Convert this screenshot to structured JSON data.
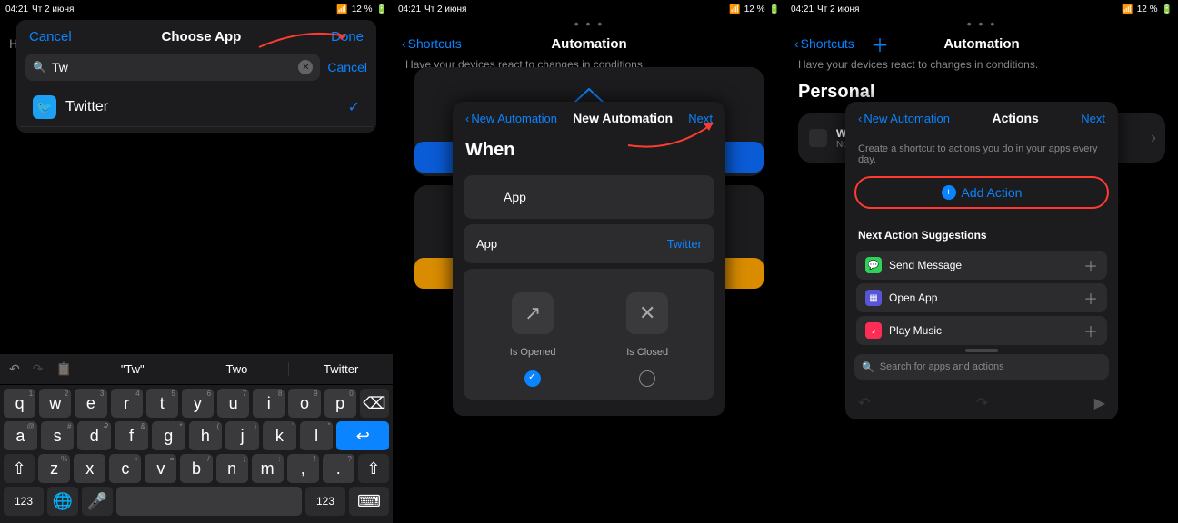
{
  "status": {
    "time": "04:21",
    "date": "Чт 2 июня",
    "battery": "12 %"
  },
  "panel1": {
    "home": "H…",
    "cancel": "Cancel",
    "title": "Choose App",
    "done": "Done",
    "search_value": "Tw",
    "search_cancel": "Cancel",
    "app_name": "Twitter",
    "suggestions": {
      "w1": "\"Tw\"",
      "w2": "Two",
      "w3": "Twitter"
    },
    "key_123": "123"
  },
  "panel2": {
    "back": "Shortcuts",
    "title": "Automation",
    "sub": "Have your devices react to changes in conditions.",
    "modal_back": "New Automation",
    "modal_title": "New Automation",
    "modal_next": "Next",
    "when": "When",
    "app": "App",
    "app_label": "App",
    "app_value": "Twitter",
    "is_opened": "Is Opened",
    "is_closed": "Is Closed"
  },
  "panel3": {
    "back": "Shortcuts",
    "title": "Automation",
    "sub": "Have your devices react to changes in conditions.",
    "personal": "Personal",
    "when_tw": "When \"Tw…",
    "no_actions": "No actions",
    "modal_back": "New Automation",
    "modal_title": "Actions",
    "modal_next": "Next",
    "hint": "Create a shortcut to actions you do in your apps every day.",
    "add_action": "Add Action",
    "sugg_title": "Next Action Suggestions",
    "sugg1": "Send Message",
    "sugg2": "Open App",
    "sugg3": "Play Music",
    "search_placeholder": "Search for apps and actions"
  }
}
